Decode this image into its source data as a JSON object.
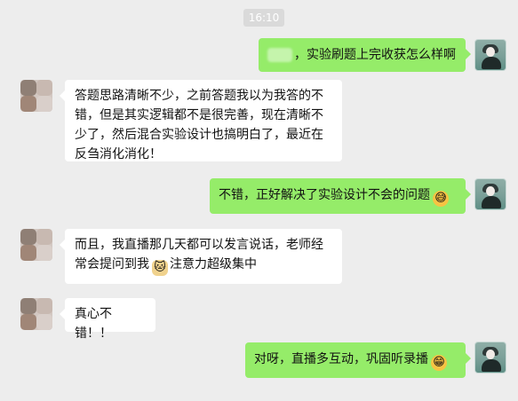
{
  "chat": {
    "timestamp": "16:10",
    "messages": [
      {
        "side": "right",
        "prefix": "，",
        "text": "实验刷题上完收获怎么样啊"
      },
      {
        "side": "left",
        "text": "答题思路清晰不少，之前答题我以为我答的不错，但是其实逻辑都不是很完善，现在清晰不少了，然后混合实验设计也搞明白了，最近在反刍消化消化！"
      },
      {
        "side": "right",
        "text": "不错，正好解决了实验设计不会的问题",
        "emoji": "sweat-smile-emoji"
      },
      {
        "side": "left",
        "text_before": "而且，我直播那几天都可以发言说话，老师经常会提问到我",
        "emoji": "cat-emoji",
        "text_after": "注意力超级集中"
      },
      {
        "side": "left",
        "text": "真心不错！！"
      },
      {
        "side": "right",
        "text": "对呀，直播多互动，巩固听录播",
        "emoji": "grinning-emoji"
      }
    ]
  }
}
